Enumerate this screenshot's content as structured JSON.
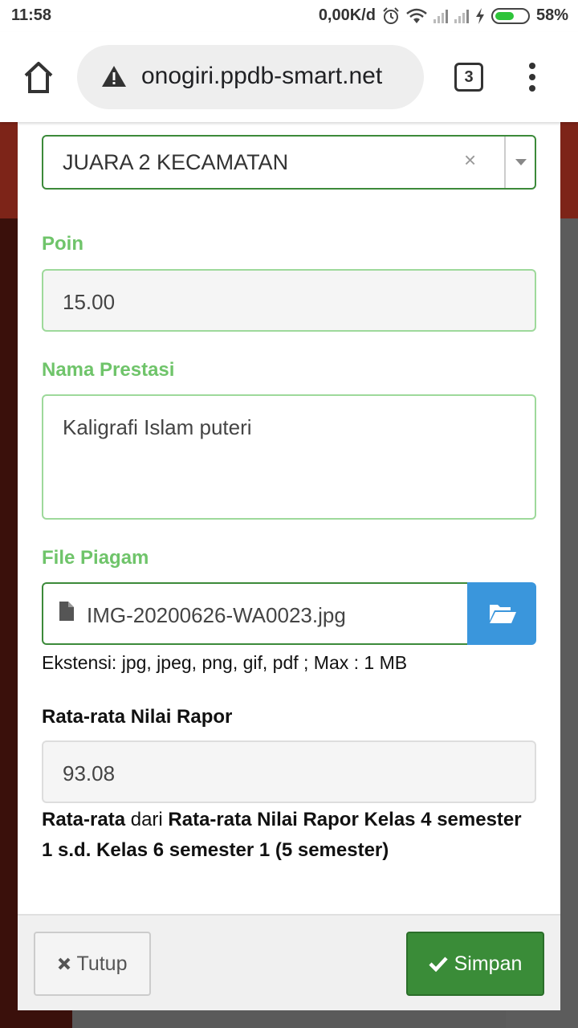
{
  "status_bar": {
    "time": "11:58",
    "network_speed": "0,00K/d",
    "battery_percent": "58%",
    "battery_level": 0.58,
    "icons": [
      "alarm-icon",
      "wifi-icon",
      "signal-icon",
      "signal-icon",
      "charging-icon",
      "battery-icon"
    ]
  },
  "browser": {
    "url": "onogiri.ppdb-smart.net",
    "tab_count": "3",
    "icons": [
      "home-icon",
      "warning-icon",
      "tabs-icon",
      "more-menu-icon"
    ]
  },
  "form": {
    "juara_select": {
      "value": "JUARA 2 KECAMATAN",
      "clear": "×"
    },
    "poin": {
      "label": "Poin",
      "value": "15.00"
    },
    "nama_prestasi": {
      "label": "Nama Prestasi",
      "value": "Kaligrafi Islam puteri"
    },
    "file_piagam": {
      "label": "File Piagam",
      "file_name": "IMG-20200626-WA0023.jpg",
      "help": "Ekstensi: jpg, jpeg, png, gif, pdf ; Max : 1 MB"
    },
    "rapor": {
      "label": "Rata-rata Nilai Rapor",
      "value": "93.08",
      "note_bold_1": "Rata-rata",
      "note_mid": " dari ",
      "note_bold_2": "Rata-rata Nilai Rapor Kelas 4 semester 1 s.d. Kelas 6 semester 1 (5 semester)"
    }
  },
  "footer": {
    "close_label": "Tutup",
    "save_label": "Simpan"
  },
  "colors": {
    "label_green": "#6fc46a",
    "save_green": "#3a8c38",
    "browse_blue": "#3a96dc"
  }
}
